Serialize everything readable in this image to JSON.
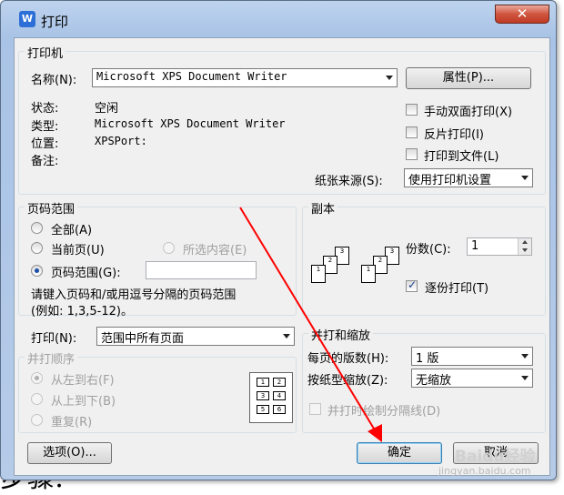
{
  "window": {
    "title": "打印",
    "icon": "wps-writer-icon",
    "close_label": "✕"
  },
  "printer": {
    "legend": "打印机",
    "name_label": "名称(N):",
    "name_value": "Microsoft XPS Document Writer",
    "properties_button": "属性(P)...",
    "status_label": "状态:",
    "status_value": "空闲",
    "type_label": "类型:",
    "type_value": "Microsoft XPS Document Writer",
    "location_label": "位置:",
    "location_value": "XPSPort:",
    "comment_label": "备注:",
    "duplex_label": "手动双面打印(X)",
    "reverse_label": "反片打印(I)",
    "to_file_label": "打印到文件(L)",
    "paper_source_label": "纸张来源(S):",
    "paper_source_value": "使用打印机设置"
  },
  "page_range": {
    "legend": "页码范围",
    "all_label": "全部(A)",
    "current_label": "当前页(U)",
    "selection_label": "所选内容(E)",
    "range_label": "页码范围(G):",
    "range_value": "",
    "hint_line1": "请键入页码和/或用逗号分隔的页码范围",
    "hint_line2": "(例如: 1,3,5-12)。"
  },
  "copies": {
    "legend": "副本",
    "count_label": "份数(C):",
    "count_value": "1",
    "collate_label": "逐份打印(T)",
    "collate_checked": true
  },
  "print_what": {
    "label": "打印(N):",
    "value": "范围中所有页面",
    "order_legend": "并打顺序",
    "ltr_label": "从左到右(F)",
    "ttb_label": "从上到下(B)",
    "repeat_label": "重复(R)",
    "cells": [
      "1",
      "2",
      "3",
      "4",
      "5",
      "6"
    ]
  },
  "zoom": {
    "legend": "并打和缩放",
    "pages_per_sheet_label": "每页的版数(H):",
    "pages_per_sheet_value": "1 版",
    "scale_label": "按纸型缩放(Z):",
    "scale_value": "无缩放",
    "divider_label": "并打时绘制分隔线(D)"
  },
  "buttons": {
    "options": "选项(O)...",
    "ok": "确定",
    "cancel": "取消"
  },
  "copy_icon_pages": [
    "1",
    "2",
    "3"
  ],
  "watermark": {
    "brand": "Baidu经验",
    "url": "jingyan.baidu.com"
  },
  "background_text": "步骤:",
  "annotation_color": "#ff0000"
}
